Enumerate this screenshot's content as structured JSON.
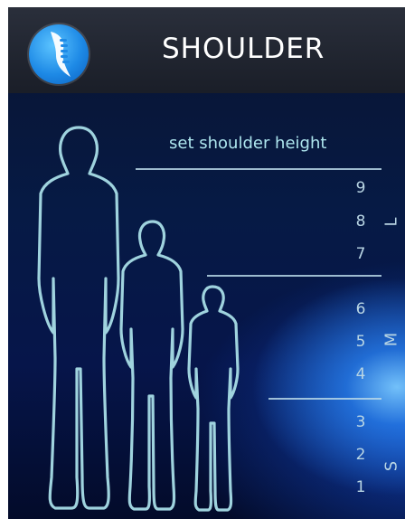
{
  "header": {
    "title": "SHOULDER",
    "logo_icon": "spine-icon"
  },
  "subtitle": "set shoulder height",
  "height_levels": [
    "9",
    "8",
    "7",
    "6",
    "5",
    "4",
    "3",
    "2",
    "1"
  ],
  "size_groups": {
    "large": "L",
    "medium": "M",
    "small": "S"
  },
  "figures": [
    {
      "name": "large-figure",
      "size": "L"
    },
    {
      "name": "medium-figure",
      "size": "M"
    },
    {
      "name": "small-figure",
      "size": "S"
    }
  ],
  "colors": {
    "header_bg": "#1f232d",
    "accent_text": "#aee6ee",
    "outline": "#9fd3de",
    "logo_blue": "#1e8ae6"
  }
}
